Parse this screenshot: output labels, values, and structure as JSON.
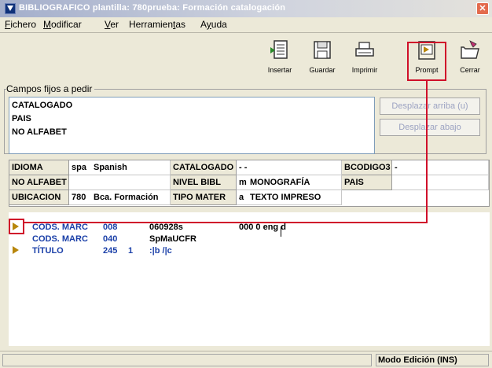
{
  "window": {
    "title": "BIBLIOGRAFICO plantilla: 780prueba: Formación catalogación",
    "close_icon": "close-icon"
  },
  "menu": {
    "items": [
      {
        "pre": "",
        "ul": "F",
        "post": "ichero"
      },
      {
        "pre": "",
        "ul": "M",
        "post": "odificar"
      },
      {
        "pre": "",
        "ul": "V",
        "post": "er"
      },
      {
        "pre": "Herramien",
        "ul": "t",
        "post": "as"
      },
      {
        "pre": "A",
        "ul": "y",
        "post": "uda"
      }
    ]
  },
  "toolbar": {
    "insertar": {
      "label": "Insertar",
      "icon": "insert-icon"
    },
    "guardar": {
      "label": "Guardar",
      "icon": "save-icon"
    },
    "imprimir": {
      "label": "Imprimir",
      "icon": "print-icon"
    },
    "prompt": {
      "label": "Prompt",
      "icon": "prompt-icon"
    },
    "cerrar": {
      "label": "Cerrar",
      "icon": "close-folder-icon"
    }
  },
  "campos_fijos": {
    "title": "Campos fijos a pedir",
    "items": [
      "CATALOGADO",
      "PAIS",
      "NO ALFABET"
    ],
    "btn_up": "Desplazar arriba (u)",
    "btn_down": "Desplazar abajo"
  },
  "fixed_fields": {
    "row1": {
      "idioma_label": "IDIOMA",
      "idioma_code": "spa",
      "idioma_value": "Spanish",
      "catalogado_label": "CATALOGADO",
      "catalogado_value": "- -",
      "bcodigo_label": "BCODIGO3",
      "bcodigo_value": "-"
    },
    "row2": {
      "noalfabet_label": "NO ALFABET",
      "noalfabet_value": "",
      "nivel_label": "NIVEL BIBL",
      "nivel_code": "m",
      "nivel_value": "MONOGRAFÍA",
      "pais_label": "PAIS",
      "pais_value": ""
    },
    "row3": {
      "ubicacion_label": "UBICACION",
      "ubicacion_code": "780",
      "ubicacion_value": "Bca. Formación",
      "tipo_label": "TIPO MATER",
      "tipo_code": "a",
      "tipo_value": "TEXTO IMPRESO"
    }
  },
  "marc": [
    {
      "label": "CODS. MARC",
      "tag": "008",
      "ind": "",
      "data": "060928s",
      "extra": "000 0 eng d"
    },
    {
      "label": "CODS. MARC",
      "tag": "040",
      "ind": "",
      "data": "SpMaUCFR",
      "extra": ""
    },
    {
      "label": "TÍTULO",
      "tag": "245",
      "ind": "1",
      "data": ":|b /|c",
      "extra": ""
    }
  ],
  "status": {
    "left": "",
    "mode": "Modo Edición (INS)"
  },
  "colors": {
    "annotation_red": "#d0102a",
    "marc_blue": "#1a3fa8",
    "arrow_gold": "#b8860b"
  }
}
